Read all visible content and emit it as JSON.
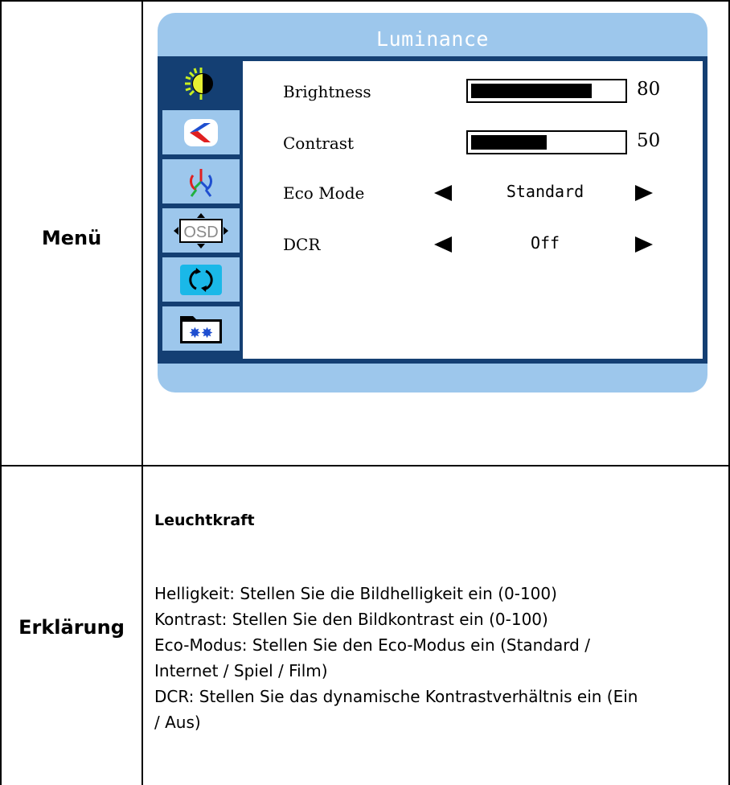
{
  "table": {
    "rows": [
      {
        "label": "Menü"
      },
      {
        "label": "Erklärung"
      }
    ]
  },
  "osd": {
    "title": "Luminance",
    "sidebar_icons": [
      {
        "icon": "luminance-icon",
        "active": true
      },
      {
        "icon": "image-setup-icon",
        "active": false
      },
      {
        "icon": "color-temp-icon",
        "active": false
      },
      {
        "icon": "osd-setup-icon",
        "active": false
      },
      {
        "icon": "reset-icon",
        "active": false
      },
      {
        "icon": "misc-icon",
        "active": false
      }
    ],
    "settings": {
      "brightness": {
        "label": "Brightness",
        "value": "80",
        "level": 80
      },
      "contrast": {
        "label": "Contrast",
        "value": "50",
        "level": 50
      },
      "eco_mode": {
        "label": "Eco Mode",
        "value": "Standard"
      },
      "dcr": {
        "label": "DCR",
        "value": "Off"
      }
    },
    "colors": {
      "frame": "#143f73",
      "panel": "#9dc7ec",
      "content": "#ffffff"
    }
  },
  "explanation": {
    "heading": "Leuchtkraft",
    "lines": [
      "Helligkeit: Stellen Sie die Bildhelligkeit ein (0-100)",
      "Kontrast: Stellen Sie den Bildkontrast ein (0-100)",
      "Eco-Modus: Stellen Sie den Eco-Modus ein (Standard /",
      "Internet / Spiel / Film)",
      "DCR: Stellen Sie das dynamische Kontrastverhältnis ein (Ein",
      "/ Aus)"
    ]
  }
}
